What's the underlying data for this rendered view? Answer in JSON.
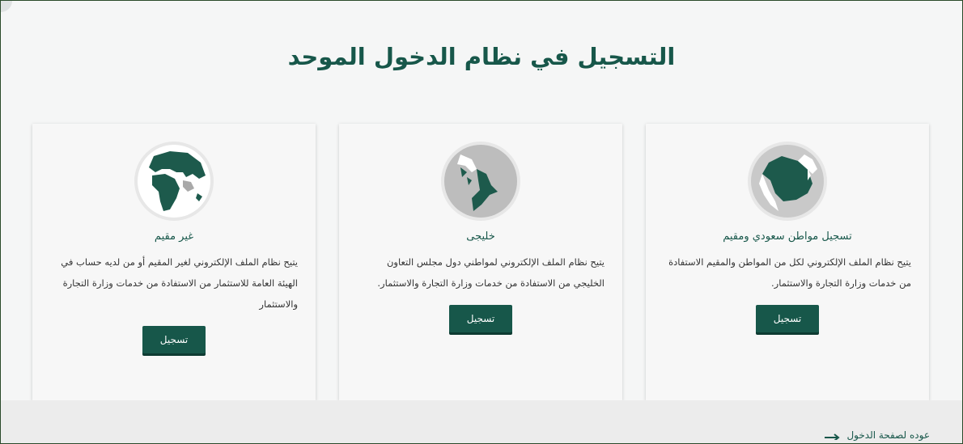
{
  "page": {
    "title": "التسجيل في نظام الدخول الموحد"
  },
  "cards": [
    {
      "title": "تسجيل مواطن سعودي ومقيم",
      "description": "يتيح نظام الملف الإلكتروني لكل من المواطن والمقيم الاستفادة من خدمات وزارة التجارة والاستثمار.",
      "button": "تسجيل",
      "icon": "saudi-map-icon"
    },
    {
      "title": "خليجى",
      "description": "يتيح نظام الملف الإلكتروني لمواطني دول مجلس التعاون الخليجي من الاستفادة من خدمات وزارة التجارة والاستثمار.",
      "button": "تسجيل",
      "icon": "gulf-map-icon"
    },
    {
      "title": "غير مقيم",
      "description": "يتيح نظام الملف الإلكتروني لغير المقيم أو من لديه حساب في الهيئة العامة للاستثمار من الاستفادة من خدمات وزارة التجارة والاستثمار",
      "button": "تسجيل",
      "icon": "world-map-icon"
    }
  ],
  "footer": {
    "back_link": "عوده لصفحة الدخول"
  },
  "colors": {
    "accent": "#17574a",
    "card_bg": "#f7f7f7",
    "page_bg": "#f5f6f6"
  }
}
